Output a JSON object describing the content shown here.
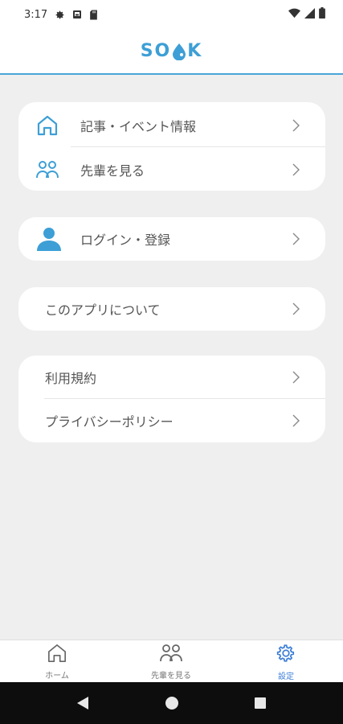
{
  "status_bar": {
    "time": "3:17",
    "icons": [
      "gear-icon",
      "image-icon",
      "sdcard-icon",
      "wifi-icon",
      "signal-icon",
      "battery-icon"
    ]
  },
  "header": {
    "logo_left": "S",
    "logo_o": "O",
    "logo_right": "K",
    "accent_color": "#3d9fd6"
  },
  "menu": {
    "articles_events": "記事・イベント情報",
    "see_seniors": "先輩を見る",
    "login_register": "ログイン・登録",
    "about_app": "このアプリについて",
    "terms": "利用規約",
    "privacy": "プライバシーポリシー"
  },
  "bottom_nav": {
    "home": "ホーム",
    "seniors": "先輩を見る",
    "settings": "設定",
    "active": "settings"
  },
  "system_nav": [
    "back-icon",
    "home-circle-icon",
    "recents-icon"
  ]
}
